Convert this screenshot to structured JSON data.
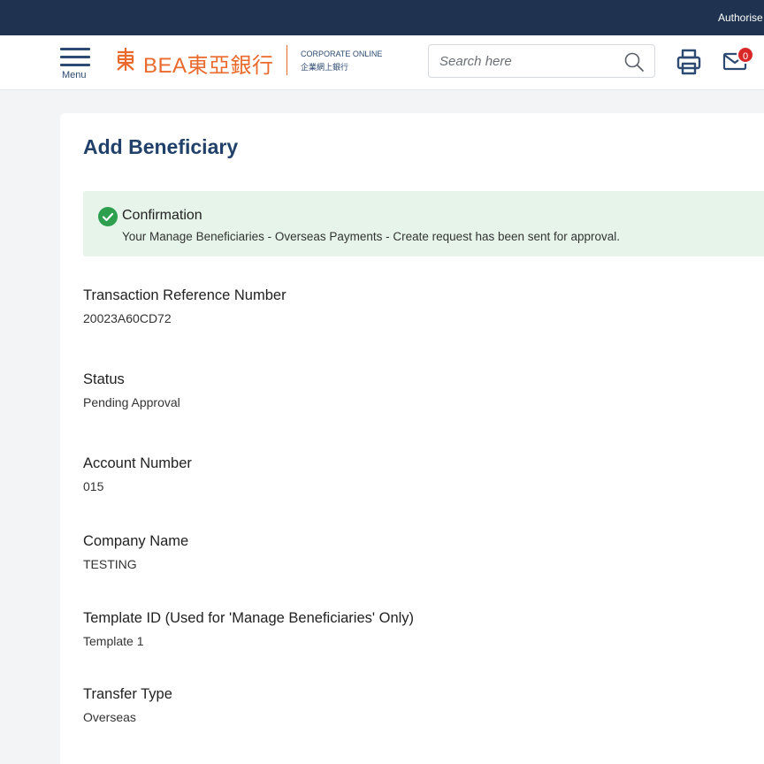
{
  "topbar": {
    "authorise_text": "Authorise"
  },
  "header": {
    "menu_label": "Menu",
    "logo_bea": "BEA東亞銀行",
    "logo_corp_en": "CORPORATE ONLINE",
    "logo_corp_zh": "企業網上銀行",
    "search_placeholder": "Search here",
    "mail_count": "0"
  },
  "page": {
    "title": "Add Beneficiary",
    "alert": {
      "title": "Confirmation",
      "message": "Your Manage Beneficiaries - Overseas Payments - Create request has been sent for approval."
    },
    "fields": [
      {
        "label": "Transaction Reference Number",
        "value": "20023A60CD72"
      },
      {
        "label": "Status",
        "value": "Pending Approval"
      },
      {
        "label": "Account Number",
        "value": "015"
      },
      {
        "label": "Company Name",
        "value": "TESTING"
      },
      {
        "label": "Template ID (Used for 'Manage Beneficiaries' Only)",
        "value": "Template 1"
      },
      {
        "label": "Transfer Type",
        "value": "Overseas"
      }
    ]
  },
  "colors": {
    "topbar": "#1f3350",
    "brand_orange": "#e96a2c",
    "navy": "#21416b",
    "success_bg": "#e6f4ea",
    "success_icon": "#2e9e4f",
    "badge": "#d92828"
  },
  "icons": [
    "menu-icon",
    "bea-emblem-icon",
    "search-icon",
    "printer-icon",
    "mail-icon",
    "check-circle-icon"
  ]
}
